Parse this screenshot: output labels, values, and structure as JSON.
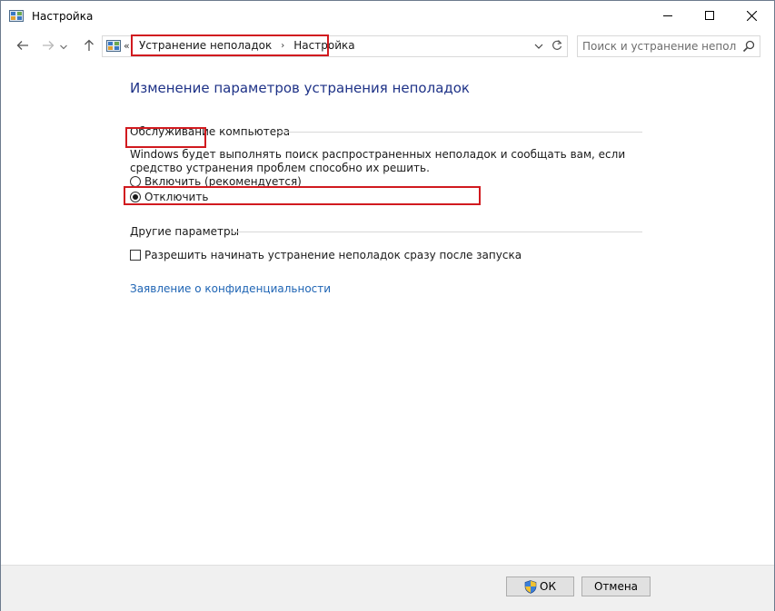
{
  "window": {
    "title": "Настройка",
    "icon": "control-panel-icon",
    "controls": {
      "minimize": "minimize-icon",
      "maximize": "maximize-icon",
      "close": "close-icon"
    }
  },
  "nav": {
    "breadcrumb_overflow": "«",
    "breadcrumbs": [
      "Устранение неполадок",
      "Настройка"
    ],
    "separator": "›",
    "search_placeholder": "Поиск и устранение неполад..."
  },
  "content": {
    "page_title": "Изменение параметров устранения неполадок",
    "maintenance": {
      "title": "Обслуживание компьютера",
      "description": "Windows будет выполнять поиск распространенных неполадок и сообщать вам, если средство устранения проблем способно их решить.",
      "options": [
        {
          "label": "Включить (рекомендуется)",
          "checked": false
        },
        {
          "label": "Отключить",
          "checked": true
        }
      ]
    },
    "other": {
      "title": "Другие параметры",
      "checkbox_label": "Разрешить начинать устранение неполадок сразу после запуска",
      "checkbox_checked": false
    },
    "privacy_link": "Заявление о конфиденциальности"
  },
  "footer": {
    "ok_label": "ОК",
    "cancel_label": "Отмена"
  },
  "colors": {
    "title_blue": "#1e3287",
    "link_blue": "#1e64b4",
    "highlight_red": "#d11a1f"
  }
}
